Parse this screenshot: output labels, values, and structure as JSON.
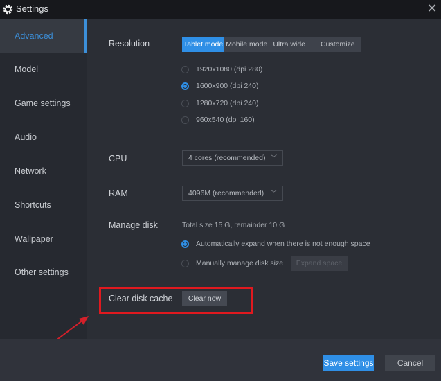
{
  "window": {
    "title": "Settings",
    "close_icon": "close-icon",
    "gear_icon": "gear-icon"
  },
  "sidebar": {
    "items": [
      {
        "label": "Advanced",
        "active": true
      },
      {
        "label": "Model"
      },
      {
        "label": "Game settings"
      },
      {
        "label": "Audio"
      },
      {
        "label": "Network"
      },
      {
        "label": "Shortcuts"
      },
      {
        "label": "Wallpaper"
      },
      {
        "label": "Other settings"
      }
    ]
  },
  "resolution": {
    "label": "Resolution",
    "modes": [
      "Tablet mode",
      "Mobile mode",
      "Ultra wide",
      "Customize"
    ],
    "selected_mode": "Tablet mode",
    "options": [
      "1920x1080  (dpi 280)",
      "1600x900  (dpi 240)",
      "1280x720  (dpi 240)",
      "960x540  (dpi 160)"
    ],
    "selected_option": "1600x900  (dpi 240)"
  },
  "cpu": {
    "label": "CPU",
    "value": "4 cores (recommended)"
  },
  "ram": {
    "label": "RAM",
    "value": "4096M (recommended)"
  },
  "disk": {
    "label": "Manage disk",
    "info": "Total size 15 G,  remainder 10 G",
    "auto_option": "Automatically expand when there is not enough space",
    "manual_option": "Manually manage disk size",
    "expand_button": "Expand space"
  },
  "cache": {
    "label": "Clear disk cache",
    "button": "Clear now"
  },
  "footer": {
    "save": "Save settings",
    "cancel": "Cancel"
  },
  "annotation": {
    "highlight_color": "#e0191f"
  }
}
